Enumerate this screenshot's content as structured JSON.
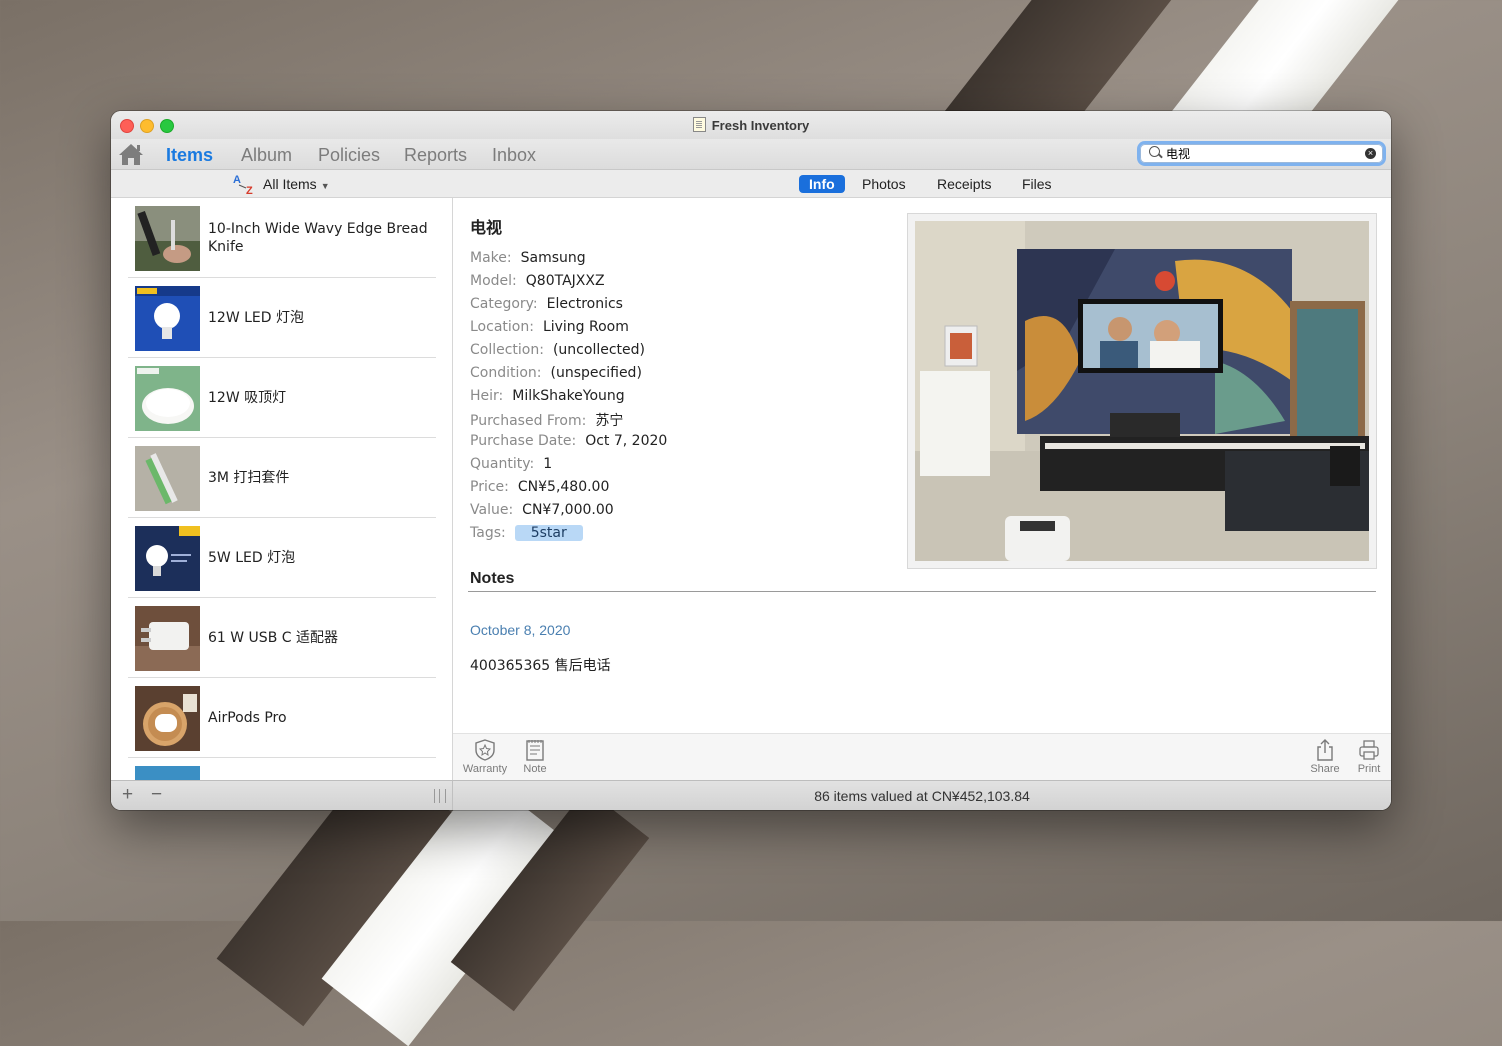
{
  "window": {
    "title": "Fresh Inventory"
  },
  "nav": {
    "tabs": [
      {
        "label": "Items",
        "active": true
      },
      {
        "label": "Album",
        "active": false
      },
      {
        "label": "Policies",
        "active": false
      },
      {
        "label": "Reports",
        "active": false
      },
      {
        "label": "Inbox",
        "active": false
      }
    ],
    "search": {
      "value": "电视"
    }
  },
  "subbar": {
    "filter": "All Items",
    "segments": [
      {
        "label": "Info",
        "active": true
      },
      {
        "label": "Photos",
        "active": false
      },
      {
        "label": "Receipts",
        "active": false
      },
      {
        "label": "Files",
        "active": false
      }
    ]
  },
  "items": [
    {
      "name": "10-Inch Wide Wavy Edge Bread Knife"
    },
    {
      "name": "12W LED 灯泡"
    },
    {
      "name": "12W 吸顶灯"
    },
    {
      "name": "3M 打扫套件"
    },
    {
      "name": "5W LED 灯泡"
    },
    {
      "name": "61 W USB C 适配器"
    },
    {
      "name": "AirPods Pro"
    }
  ],
  "detail": {
    "title": "电视",
    "fields": [
      {
        "key": "Make:",
        "value": "Samsung"
      },
      {
        "key": "Model:",
        "value": "Q80TAJXXZ"
      },
      {
        "key": "Category:",
        "value": "Electronics"
      },
      {
        "key": "Location:",
        "value": "Living Room"
      },
      {
        "key": "Collection:",
        "value": "(uncollected)"
      },
      {
        "key": "Condition:",
        "value": "(unspecified)"
      },
      {
        "key": "Heir:",
        "value": "MilkShakeYoung"
      },
      {
        "key": "Purchased From:",
        "value": "苏宁"
      },
      {
        "key": "Purchase Date:",
        "value": "Oct 7, 2020"
      },
      {
        "key": "Quantity:",
        "value": "1"
      },
      {
        "key": "Price:",
        "value": "CN¥5,480.00"
      },
      {
        "key": "Value:",
        "value": "CN¥7,000.00"
      }
    ],
    "tags_label": "Tags:",
    "tag": "5star",
    "notes_heading": "Notes",
    "note_date": "October 8, 2020",
    "note_text": "400365365 售后电话"
  },
  "tools": {
    "warranty": "Warranty",
    "note": "Note",
    "share": "Share",
    "print": "Print"
  },
  "status": {
    "add": "+",
    "remove": "−",
    "summary": "86 items valued at CN¥452,103.84"
  },
  "colors": {
    "accent": "#1a7ae0",
    "tag_bg": "#b9d8f6",
    "note_date": "#4a7fb0"
  }
}
